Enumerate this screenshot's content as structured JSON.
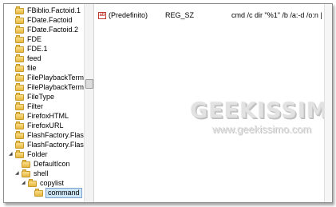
{
  "tree": {
    "items": [
      {
        "label": "FBiblio.Factoid.1",
        "expander": ""
      },
      {
        "label": "FDate.Factoid",
        "expander": ""
      },
      {
        "label": "FDate.Factoid.2",
        "expander": ""
      },
      {
        "label": "FDE",
        "expander": ""
      },
      {
        "label": "FDE.1",
        "expander": ""
      },
      {
        "label": "feed",
        "expander": ""
      },
      {
        "label": "file",
        "expander": ""
      },
      {
        "label": "FilePlaybackTerminal.",
        "expander": ""
      },
      {
        "label": "FilePlaybackTerminal.",
        "expander": ""
      },
      {
        "label": "FileType",
        "expander": ""
      },
      {
        "label": "Filter",
        "expander": ""
      },
      {
        "label": "FirefoxHTML",
        "expander": ""
      },
      {
        "label": "FirefoxURL",
        "expander": ""
      },
      {
        "label": "FlashFactory.FlashFac",
        "expander": ""
      },
      {
        "label": "FlashFactory.FlashFac",
        "expander": ""
      },
      {
        "label": "Folder",
        "expander": "◢"
      },
      {
        "label": "DefaultIcon",
        "expander": ""
      },
      {
        "label": "shell",
        "expander": "◢"
      },
      {
        "label": "copylist",
        "expander": "◢"
      },
      {
        "label": "command",
        "expander": ""
      }
    ]
  },
  "values": {
    "rows": [
      {
        "icon": "ab",
        "name": "(Predefinito)",
        "type": "REG_SZ",
        "data": "cmd /c dir \"%1\" /b /a:-d /o:n | clip"
      }
    ]
  },
  "watermark": {
    "title": "GEEKISSIMO",
    "url": "www.geekissimo.com"
  }
}
